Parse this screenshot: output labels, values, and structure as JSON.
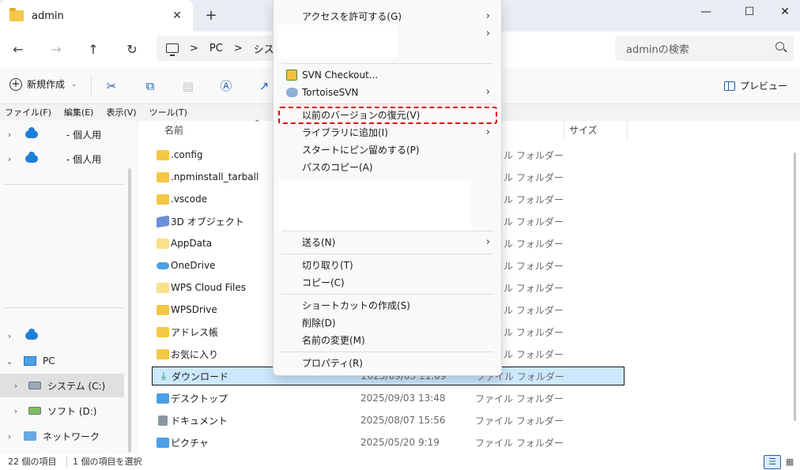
{
  "tab": {
    "title": "admin",
    "close_glyph": "✕",
    "new_glyph": "+"
  },
  "window_controls": {
    "minimize": "—",
    "maximize": "☐",
    "close": "✕"
  },
  "nav": {
    "back": "←",
    "forward": "→",
    "up": "↑",
    "refresh": "↻",
    "breadcrumb": [
      "PC",
      "シス"
    ],
    "breadcrumb_sep": ">",
    "search_placeholder": "adminの検索"
  },
  "commandbar": {
    "new_label": "新規作成",
    "preview_label": "プレビュー",
    "icons": [
      "cut-icon",
      "copy-icon",
      "paste-icon",
      "rename-icon",
      "share-icon"
    ]
  },
  "menubar": [
    "ファイル(F)",
    "編集(E)",
    "表示(V)",
    "ツール(T)"
  ],
  "navpane": {
    "items": [
      {
        "label": "- 個人用",
        "icon": "onedrive-icon"
      },
      {
        "label": "- 個人用",
        "icon": "onedrive-icon"
      },
      {
        "label": "",
        "icon": "onedrive-icon"
      },
      {
        "label": "PC",
        "icon": "pc-icon"
      },
      {
        "label": "システム (C:)",
        "icon": "drive-icon"
      },
      {
        "label": "ソフト (D:)",
        "icon": "drive-icon"
      },
      {
        "label": "ネットワーク",
        "icon": "network-icon"
      }
    ]
  },
  "columns": {
    "name": "名前",
    "size": "サイズ"
  },
  "files": [
    {
      "name": ".config",
      "date": "",
      "type": "ファイル フォルダー",
      "icon": "folder"
    },
    {
      "name": ".npminstall_tarball",
      "date": "",
      "type": "ファイル フォルダー",
      "icon": "folder"
    },
    {
      "name": ".vscode",
      "date": "",
      "type": "ファイル フォルダー",
      "icon": "folder"
    },
    {
      "name": "3D オブジェクト",
      "date": "",
      "type": "ファイル フォルダー",
      "icon": "cube"
    },
    {
      "name": "AppData",
      "date": "",
      "type": "ファイル フォルダー",
      "icon": "folder-faded"
    },
    {
      "name": "OneDrive",
      "date": "",
      "type": "ファイル フォルダー",
      "icon": "onedrive"
    },
    {
      "name": "WPS Cloud Files",
      "date": "",
      "type": "ファイル フォルダー",
      "icon": "folder-faded"
    },
    {
      "name": "WPSDrive",
      "date": "",
      "type": "ファイル フォルダー",
      "icon": "folder"
    },
    {
      "name": "アドレス帳",
      "date": "",
      "type": "ファイル フォルダー",
      "icon": "folder"
    },
    {
      "name": "お気に入り",
      "date": "",
      "type": "ファイル フォルダー",
      "icon": "folder"
    },
    {
      "name": "ダウンロード",
      "date": "2025/09/03 11:09",
      "type": "ファイル フォルダー",
      "icon": "download"
    },
    {
      "name": "デスクトップ",
      "date": "2025/09/03 13:48",
      "type": "ファイル フォルダー",
      "icon": "desktop"
    },
    {
      "name": "ドキュメント",
      "date": "2025/08/07 15:56",
      "type": "ファイル フォルダー",
      "icon": "document"
    },
    {
      "name": "ピクチャ",
      "date": "2025/05/20 9:19",
      "type": "ファイル フォルダー",
      "icon": "picture"
    }
  ],
  "context_menu": {
    "give_access": "アクセスを許可する(G)",
    "svn_checkout": "SVN Checkout...",
    "tortoise": "TortoiseSVN",
    "restore_versions": "以前のバージョンの復元(V)",
    "add_library": "ライブラリに追加(I)",
    "pin_start": "スタートにピン留めする(P)",
    "copy_path": "パスのコピー(A)",
    "send_to": "送る(N)",
    "cut": "切り取り(T)",
    "copy": "コピー(C)",
    "create_shortcut": "ショートカットの作成(S)",
    "delete": "削除(D)",
    "rename": "名前の変更(M)",
    "properties": "プロパティ(R)",
    "submenu_glyph": "›"
  },
  "status": {
    "item_count": "22 個の項目",
    "selected": "1 個の項目を選択"
  },
  "colors": {
    "accent": "#1f5fad",
    "selection": "#cce8ff",
    "highlight_border": "#e00000",
    "folder": "#f4c744"
  }
}
